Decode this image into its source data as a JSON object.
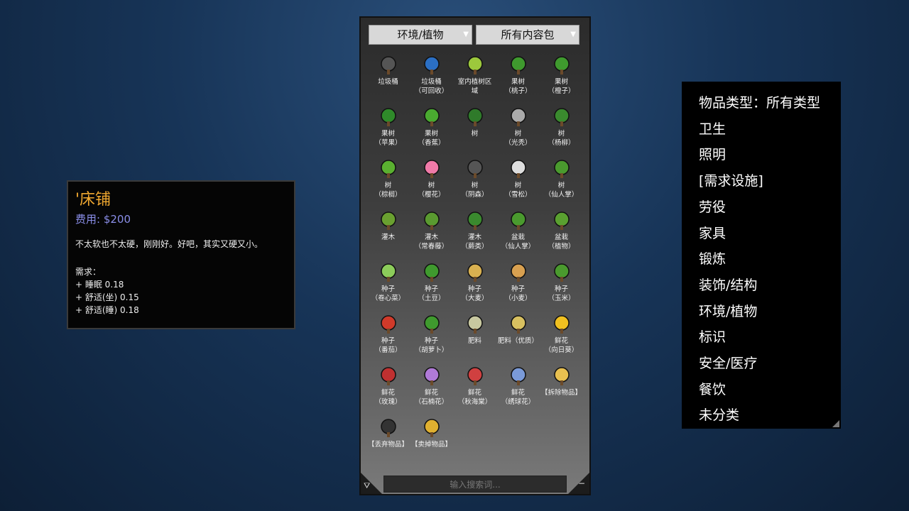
{
  "tooltip": {
    "title": "'床铺",
    "cost": "费用: $200",
    "description": "不太软也不太硬，刚刚好。好吧，其实又硬又小。",
    "needs_label": "需求：",
    "needs": [
      "+ 睡眠 0.18",
      "+ 舒适(坐) 0.15",
      "+ 舒适(睡) 0.18"
    ]
  },
  "build": {
    "category_dropdown": "环境/植物",
    "pack_dropdown": "所有内容包",
    "search_placeholder": "输入搜索词...",
    "items": [
      {
        "label": "垃圾桶",
        "icon": "trash-bin",
        "color": "#555"
      },
      {
        "label": "垃圾桶\n（可回收）",
        "icon": "recycle-bin",
        "color": "#2b6fc4"
      },
      {
        "label": "室内植树区\n域",
        "icon": "planting-zone",
        "color": "#9cc83c"
      },
      {
        "label": "果树\n（桃子）",
        "icon": "peach-tree",
        "color": "#3f9a2e"
      },
      {
        "label": "果树\n（橙子）",
        "icon": "orange-tree",
        "color": "#3f9a2e"
      },
      {
        "label": "果树\n（苹果）",
        "icon": "apple-tree",
        "color": "#2f8a2a"
      },
      {
        "label": "果树\n（香蕉）",
        "icon": "banana-tree",
        "color": "#4aaa30"
      },
      {
        "label": "树",
        "icon": "tree",
        "color": "#2f7a2a"
      },
      {
        "label": "树\n（光秃）",
        "icon": "bare-tree",
        "color": "#aaa"
      },
      {
        "label": "树\n（杨柳）",
        "icon": "willow-tree",
        "color": "#3a8a2e"
      },
      {
        "label": "树\n（棕榈）",
        "icon": "palm-tree",
        "color": "#5ab030"
      },
      {
        "label": "树\n（樱花）",
        "icon": "cherry-tree",
        "color": "#f07aa8"
      },
      {
        "label": "树\n（阴森）",
        "icon": "spooky-tree",
        "color": "#555"
      },
      {
        "label": "树\n（雪松）",
        "icon": "snow-pine",
        "color": "#ddd"
      },
      {
        "label": "树\n（仙人掌）",
        "icon": "cactus",
        "color": "#4a9a2e"
      },
      {
        "label": "灌木",
        "icon": "bush",
        "color": "#6aa030"
      },
      {
        "label": "灌木\n（常春藤）",
        "icon": "ivy-bush",
        "color": "#5a9a30"
      },
      {
        "label": "灌木\n（蕨类）",
        "icon": "fern",
        "color": "#3a8a2e"
      },
      {
        "label": "盆栽\n（仙人掌）",
        "icon": "potted-cactus",
        "color": "#4a9a2e"
      },
      {
        "label": "盆栽\n（植物）",
        "icon": "potted-plant",
        "color": "#5aa030"
      },
      {
        "label": "种子\n（卷心菜）",
        "icon": "cabbage-seed",
        "color": "#8ccc5a"
      },
      {
        "label": "种子\n（土豆）",
        "icon": "potato-seed",
        "color": "#3f9a2e"
      },
      {
        "label": "种子\n（大麦）",
        "icon": "barley-seed",
        "color": "#d8b050"
      },
      {
        "label": "种子\n（小麦）",
        "icon": "wheat-seed",
        "color": "#d8a050"
      },
      {
        "label": "种子\n（玉米）",
        "icon": "corn-seed",
        "color": "#4a9a2e"
      },
      {
        "label": "种子\n（番茄）",
        "icon": "tomato-seed",
        "color": "#d03a2a"
      },
      {
        "label": "种子\n（胡萝卜）",
        "icon": "carrot-seed",
        "color": "#3f9a2e"
      },
      {
        "label": "肥料",
        "icon": "fertilizer-bag",
        "color": "#c8c8a0"
      },
      {
        "label": "肥料（优质）",
        "icon": "premium-fertilizer-bag",
        "color": "#d8c060"
      },
      {
        "label": "鲜花\n（向日葵）",
        "icon": "sunflower",
        "color": "#f0c020"
      },
      {
        "label": "鲜花\n（玫瑰）",
        "icon": "rose",
        "color": "#c03030"
      },
      {
        "label": "鲜花\n（石楠花）",
        "icon": "heather",
        "color": "#b07ad8"
      },
      {
        "label": "鲜花\n（秋海棠）",
        "icon": "begonia",
        "color": "#d04040"
      },
      {
        "label": "鲜花\n（绣球花）",
        "icon": "hydrangea",
        "color": "#7a9ad8"
      },
      {
        "label": "【拆除物品】",
        "icon": "demolish",
        "color": "#e8c050"
      },
      {
        "label": "【丢弃物品】",
        "icon": "garbage-bag",
        "color": "#333"
      },
      {
        "label": "【卖掉物品】",
        "icon": "money-bag",
        "color": "#e0b030"
      }
    ]
  },
  "categories": {
    "header": "物品类型：所有类型",
    "items": [
      "卫生",
      "照明",
      "[需求设施]",
      "劳役",
      "家具",
      "锻炼",
      "装饰/结构",
      "环境/植物",
      "标识",
      "安全/医疗",
      "餐饮",
      "未分类"
    ]
  }
}
